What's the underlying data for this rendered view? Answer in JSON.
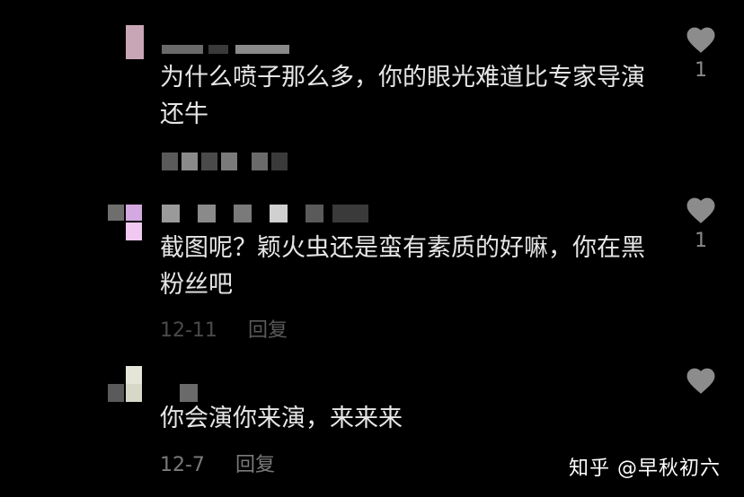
{
  "comments": [
    {
      "text": "为什么喷子那么多，你的眼光难道比专家导演还牛",
      "likes": "1"
    },
    {
      "text": "截图呢？颖火虫还是蛮有素质的好嘛，你在黑粉丝吧",
      "likes": "1",
      "date": "12-11",
      "reply": "回复"
    },
    {
      "text": "你会演你来演，来来来",
      "date": "12-7",
      "reply": "回复"
    }
  ],
  "watermark": "知乎 @早秋初六",
  "colors": {
    "background": "#000000",
    "text": "#e6e6e6",
    "meta": "#7a7a7a",
    "heart": "#8c8c8c"
  },
  "icons": {
    "like": "heart-icon"
  }
}
